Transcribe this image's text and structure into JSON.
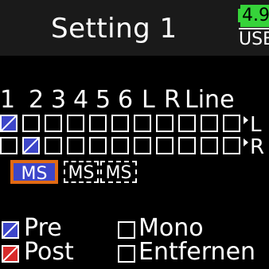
{
  "header": {
    "title": "Setting 1",
    "battery_level": "4.9",
    "power_source": "USB"
  },
  "columns": [
    "1",
    "2",
    "3",
    "4",
    "5",
    "6",
    "L",
    "R",
    "Line"
  ],
  "outputs": [
    {
      "label": "L",
      "checks": [
        true,
        false,
        false,
        false,
        false,
        false,
        false,
        false,
        false
      ]
    },
    {
      "label": "R",
      "checks": [
        false,
        true,
        false,
        false,
        false,
        false,
        false,
        false,
        false
      ]
    }
  ],
  "ms_buttons": [
    {
      "label": "MS",
      "state": "active"
    },
    {
      "label": "MS",
      "state": "inactive"
    },
    {
      "label": "MS",
      "state": "inactive"
    }
  ],
  "legend": {
    "pre": "Pre",
    "post": "Post",
    "mono": "Mono",
    "remove": "Entfernen"
  },
  "colors": {
    "pre": "#3d46c9",
    "post": "#d82a2a",
    "selection": "#e06a14",
    "battery": "#36d33a"
  }
}
